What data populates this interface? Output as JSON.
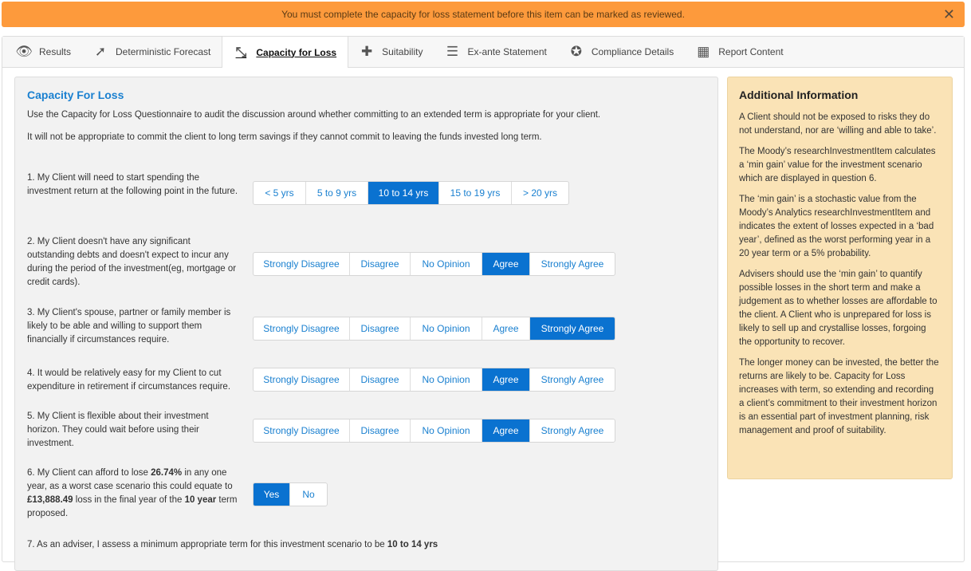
{
  "banner": {
    "message": "You must complete the capacity for loss statement before this item can be marked as reviewed.",
    "close": "✕"
  },
  "tabs": [
    {
      "label": "Results",
      "icon": "eye-icon",
      "glyph": "👁"
    },
    {
      "label": "Deterministic Forecast",
      "icon": "forecast-icon",
      "glyph": "➚"
    },
    {
      "label": "Capacity for Loss",
      "icon": "compress-icon",
      "glyph": "⤡",
      "active": true
    },
    {
      "label": "Suitability",
      "icon": "puzzle-icon",
      "glyph": "✚"
    },
    {
      "label": "Ex-ante Statement",
      "icon": "document-arrow-icon",
      "glyph": "☰"
    },
    {
      "label": "Compliance Details",
      "icon": "award-icon",
      "glyph": "✪"
    },
    {
      "label": "Report Content",
      "icon": "layout-icon",
      "glyph": "▦"
    }
  ],
  "main": {
    "title": "Capacity For Loss",
    "intro1": "Use the Capacity for Loss Questionnaire to audit the discussion around whether committing to an extended term is appropriate for your client.",
    "intro2": "It will not be appropriate to commit the client to long term savings if they cannot commit to leaving the funds invested long term.",
    "questions": [
      {
        "text": "1. My Client will need to start spending the investment return at the following point in the future.",
        "options": [
          "< 5 yrs",
          "5 to 9 yrs",
          "10 to 14 yrs",
          "15 to 19 yrs",
          "> 20 yrs"
        ],
        "selected": 2
      },
      {
        "text": "2. My Client doesn't have any significant outstanding debts and doesn't expect to incur any during the period of the investment(eg, mortgage or credit cards).",
        "options": [
          "Strongly Disagree",
          "Disagree",
          "No Opinion",
          "Agree",
          "Strongly Agree"
        ],
        "selected": 3
      },
      {
        "text": "3. My Client's spouse, partner or family member is likely to be able and willing to support them financially if circumstances require.",
        "options": [
          "Strongly Disagree",
          "Disagree",
          "No Opinion",
          "Agree",
          "Strongly Agree"
        ],
        "selected": 4
      },
      {
        "text": "4. It would be relatively easy for my Client to cut expenditure in retirement if circumstances require.",
        "options": [
          "Strongly Disagree",
          "Disagree",
          "No Opinion",
          "Agree",
          "Strongly Agree"
        ],
        "selected": 3
      },
      {
        "text": "5. My Client is flexible about their investment horizon. They could wait before using their investment.",
        "options": [
          "Strongly Disagree",
          "Disagree",
          "No Opinion",
          "Agree",
          "Strongly Agree"
        ],
        "selected": 3
      }
    ],
    "q6": {
      "p1": "6. My Client can afford to lose ",
      "pct": "26.74%",
      "p2": " in any one year, as a worst case scenario this could equate to ",
      "amount": "£13,888.49",
      "p3": " loss in the final year of the ",
      "term": "10 year",
      "p4": " term proposed.",
      "options": [
        "Yes",
        "No"
      ],
      "selected": 0
    },
    "q7": {
      "text": "7. As an adviser, I assess a minimum appropriate term for this investment scenario to be ",
      "value": "10 to 14 yrs"
    }
  },
  "side": {
    "title": "Additional Information",
    "paragraphs": [
      "A Client should not be exposed to risks they do not understand, nor are ‘willing and able to take’.",
      "The Moody’s researchInvestmentItem calculates a ‘min gain’ value for the investment scenario which are displayed in question 6.",
      "The ‘min gain’ is a stochastic value from the Moody’s Analytics researchInvestmentItem and indicates the extent of losses expected in a ‘bad year’, defined as the worst performing year in a 20 year term or a 5% probability.",
      "Advisers should use the ‘min gain’ to quantify possible losses in the short term and make a judgement as to whether losses are affordable to the client. A Client who is unprepared for loss is likely to sell up and crystallise losses, forgoing the opportunity to recover.",
      "The longer money can be invested, the better the returns are likely to be. Capacity for Loss increases with term, so extending and recording a client’s commitment to their investment horizon is an essential part of investment planning, risk management and proof of suitability."
    ]
  }
}
